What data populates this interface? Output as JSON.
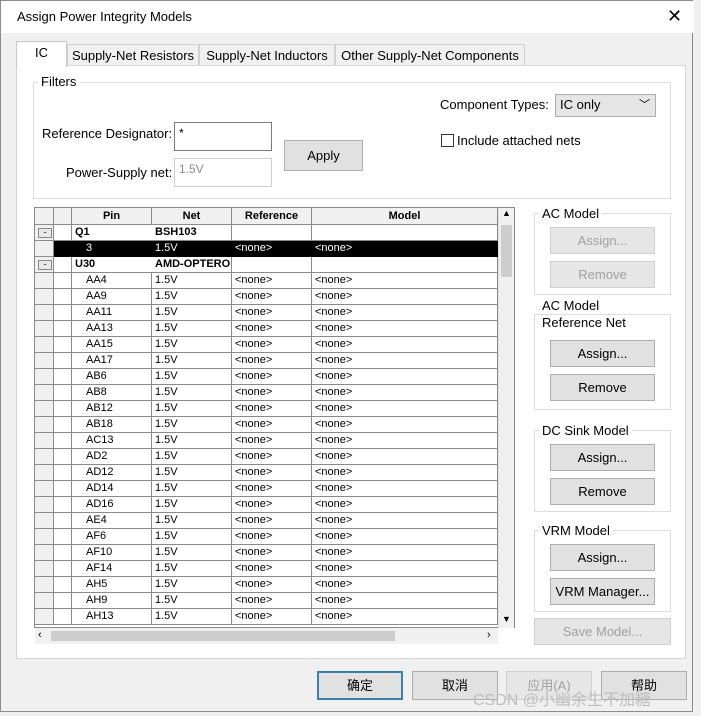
{
  "dialog": {
    "title": "Assign Power Integrity Models"
  },
  "tabs": [
    "IC",
    "Supply-Net Resistors",
    "Supply-Net Inductors",
    "Other Supply-Net Components"
  ],
  "filters": {
    "group_label": "Filters",
    "component_types_label": "Component Types:",
    "component_types_value": "IC only",
    "include_attached_label": "Include attached nets",
    "ref_designator_label": "Reference Designator:",
    "ref_designator_value": "*",
    "power_supply_label": "Power-Supply net:",
    "power_supply_value": "1.5V",
    "apply_label": "Apply"
  },
  "grid": {
    "columns": [
      "Pin",
      "Net",
      "Reference",
      "Model"
    ],
    "groups": [
      {
        "ref": "Q1",
        "part": "BSH103",
        "rows": [
          [
            "3",
            "1.5V",
            "<none>",
            "<none>"
          ]
        ]
      },
      {
        "ref": "U30",
        "part": "AMD-OPTERO",
        "rows": [
          [
            "AA4",
            "1.5V",
            "<none>",
            "<none>"
          ],
          [
            "AA9",
            "1.5V",
            "<none>",
            "<none>"
          ],
          [
            "AA11",
            "1.5V",
            "<none>",
            "<none>"
          ],
          [
            "AA13",
            "1.5V",
            "<none>",
            "<none>"
          ],
          [
            "AA15",
            "1.5V",
            "<none>",
            "<none>"
          ],
          [
            "AA17",
            "1.5V",
            "<none>",
            "<none>"
          ],
          [
            "AB6",
            "1.5V",
            "<none>",
            "<none>"
          ],
          [
            "AB8",
            "1.5V",
            "<none>",
            "<none>"
          ],
          [
            "AB12",
            "1.5V",
            "<none>",
            "<none>"
          ],
          [
            "AB18",
            "1.5V",
            "<none>",
            "<none>"
          ],
          [
            "AC13",
            "1.5V",
            "<none>",
            "<none>"
          ],
          [
            "AD2",
            "1.5V",
            "<none>",
            "<none>"
          ],
          [
            "AD12",
            "1.5V",
            "<none>",
            "<none>"
          ],
          [
            "AD14",
            "1.5V",
            "<none>",
            "<none>"
          ],
          [
            "AD16",
            "1.5V",
            "<none>",
            "<none>"
          ],
          [
            "AE4",
            "1.5V",
            "<none>",
            "<none>"
          ],
          [
            "AF6",
            "1.5V",
            "<none>",
            "<none>"
          ],
          [
            "AF10",
            "1.5V",
            "<none>",
            "<none>"
          ],
          [
            "AF14",
            "1.5V",
            "<none>",
            "<none>"
          ],
          [
            "AH5",
            "1.5V",
            "<none>",
            "<none>"
          ],
          [
            "AH9",
            "1.5V",
            "<none>",
            "<none>"
          ],
          [
            "AH13",
            "1.5V",
            "<none>",
            "<none>"
          ]
        ]
      }
    ],
    "expander_symbol": "-"
  },
  "ac_model": {
    "label": "AC Model",
    "assign": "Assign...",
    "remove": "Remove"
  },
  "ac_ref": {
    "label1": "AC Model",
    "label2": "Reference Net",
    "assign": "Assign...",
    "remove": "Remove"
  },
  "dc_sink": {
    "label": "DC Sink Model",
    "assign": "Assign...",
    "remove": "Remove"
  },
  "vrm": {
    "label": "VRM Model",
    "assign": "Assign...",
    "manager": "VRM Manager..."
  },
  "save_model": "Save Model...",
  "footer": {
    "ok": "确定",
    "cancel": "取消",
    "apply": "应用(A)",
    "help": "帮助"
  },
  "watermark": "CSDN @小幽余生不加糖",
  "colors": {
    "selection": "#000000",
    "default_button_border": "#3c7fb1"
  }
}
